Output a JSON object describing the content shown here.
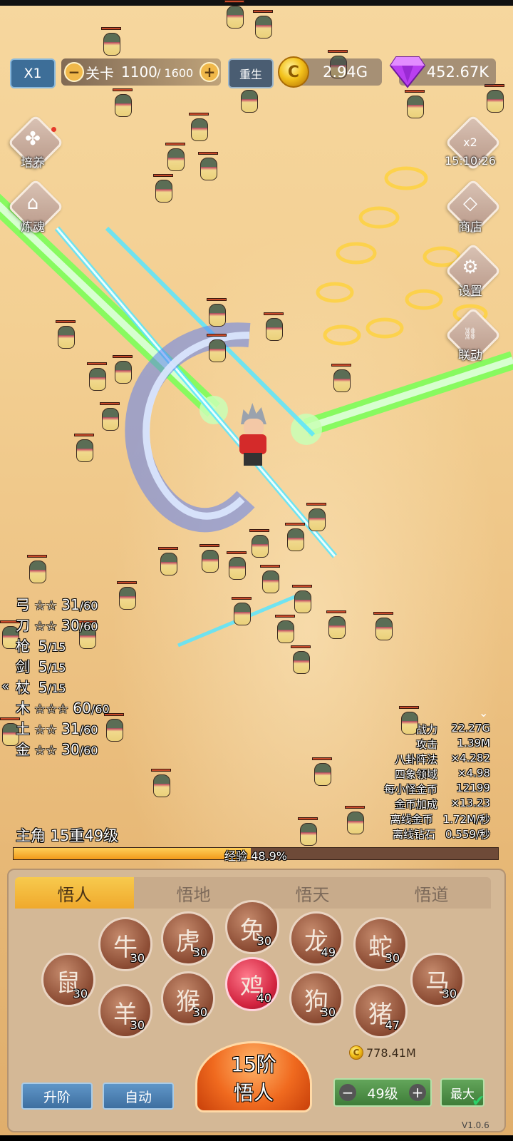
{
  "hud": {
    "speed": "X1",
    "stage_label": "关卡",
    "stage_current": "1100",
    "stage_total": "/ 1600",
    "rebirth": "重生",
    "gold": "2.94G",
    "gems": "452.67K",
    "minus": "−",
    "plus": "+"
  },
  "left_menu": [
    {
      "label": "培养",
      "icon": "clover-icon"
    },
    {
      "label": "炼魂",
      "icon": "house-icon"
    }
  ],
  "right_menu": {
    "boost": {
      "label": "x2",
      "timer": "15:10:26",
      "icon": "money-bag-icon"
    },
    "items": [
      {
        "label": "商店",
        "icon": "diamond-icon"
      },
      {
        "label": "设置",
        "icon": "gear-icon"
      },
      {
        "label": "联动",
        "icon": "link-icon"
      }
    ]
  },
  "weapons": [
    {
      "name": "弓",
      "stars": "☆☆",
      "value": "31",
      "max": "/60"
    },
    {
      "name": "刀",
      "stars": "☆☆",
      "value": "30",
      "max": "/60"
    },
    {
      "name": "枪",
      "stars": "",
      "value": "5",
      "max": "/15"
    },
    {
      "name": "剑",
      "stars": "",
      "value": "5",
      "max": "/15"
    },
    {
      "name": "杖",
      "stars": "",
      "value": "5",
      "max": "/15"
    },
    {
      "name": "木",
      "stars": "☆☆☆",
      "value": "60",
      "max": "/60"
    },
    {
      "name": "土",
      "stars": "☆☆",
      "value": "31",
      "max": "/60"
    },
    {
      "name": "金",
      "stars": "☆☆",
      "value": "30",
      "max": "/60"
    }
  ],
  "stats": [
    {
      "label": "战力",
      "value": "22.27G"
    },
    {
      "label": "攻击",
      "value": "1.39M"
    },
    {
      "label": "八卦阵法",
      "value": "×4.282"
    },
    {
      "label": "四象领域",
      "value": "×4.98"
    },
    {
      "label": "每小怪金币",
      "value": "12199"
    },
    {
      "label": "金币加成",
      "value": "×13.23"
    },
    {
      "label": "离线金币",
      "value": "1.72M/秒"
    },
    {
      "label": "离线钻石",
      "value": "0.559/秒"
    }
  ],
  "hero": {
    "title": "主角 15重49级",
    "exp_label": "经验",
    "exp_text": "48.9%",
    "exp_progress": 0.489
  },
  "tabs": [
    "悟人",
    "悟地",
    "悟天",
    "悟道"
  ],
  "zodiac": [
    {
      "name": "rat",
      "glyph": "鼠",
      "level": "30"
    },
    {
      "name": "ox",
      "glyph": "牛",
      "level": "30"
    },
    {
      "name": "tiger",
      "glyph": "虎",
      "level": "30"
    },
    {
      "name": "rabbit",
      "glyph": "兔",
      "level": "30"
    },
    {
      "name": "dragon",
      "glyph": "龙",
      "level": "49"
    },
    {
      "name": "snake",
      "glyph": "蛇",
      "level": "30"
    },
    {
      "name": "horse",
      "glyph": "马",
      "level": "30"
    },
    {
      "name": "goat",
      "glyph": "羊",
      "level": "30"
    },
    {
      "name": "monkey",
      "glyph": "猴",
      "level": "30"
    },
    {
      "name": "rooster",
      "glyph": "鸡",
      "level": "40"
    },
    {
      "name": "dog",
      "glyph": "狗",
      "level": "30"
    },
    {
      "name": "pig",
      "glyph": "猪",
      "level": "47"
    }
  ],
  "bottom": {
    "upgrade": "升阶",
    "auto": "自动",
    "rank_line1": "15阶",
    "rank_line2": "悟人",
    "cost": "778.41M",
    "level": "49级",
    "max": "最大",
    "version": "V1.0.6"
  }
}
